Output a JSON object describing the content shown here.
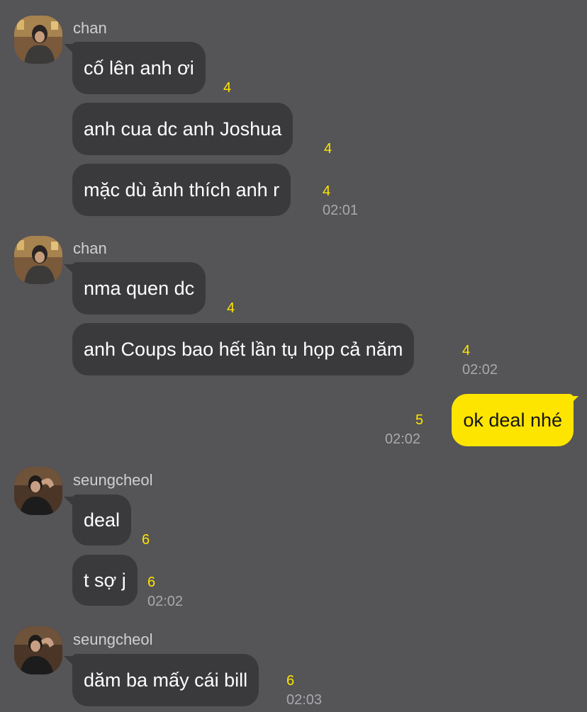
{
  "messages": {
    "g1": {
      "sender": "chan",
      "m1": {
        "text": "cố lên anh ơi",
        "count": "4"
      },
      "m2": {
        "text": "anh cua dc anh Joshua",
        "count": "4"
      },
      "m3": {
        "text": "mặc dù ảnh thích anh r",
        "count": "4",
        "time": "02:01"
      }
    },
    "g2": {
      "sender": "chan",
      "m1": {
        "text": "nma quen dc",
        "count": "4"
      },
      "m2": {
        "text": "anh Coups bao hết lần tụ họp cả năm",
        "count": "4",
        "time": "02:02"
      }
    },
    "g3": {
      "m1": {
        "text": "ok deal nhé",
        "count": "5",
        "time": "02:02"
      }
    },
    "g4": {
      "sender": "seungcheol",
      "m1": {
        "text": "deal",
        "count": "6"
      },
      "m2": {
        "text": "t sợ j",
        "count": "6",
        "time": "02:02"
      }
    },
    "g5": {
      "sender": "seungcheol",
      "m1": {
        "text": "dăm ba mấy cái bill",
        "count": "6",
        "time": "02:03"
      }
    }
  },
  "colors": {
    "background": "#555457",
    "incoming_bubble": "#3a3a3d",
    "outgoing_bubble": "#fee500",
    "unread_count": "#fee500",
    "timestamp": "#a9a9ad"
  }
}
